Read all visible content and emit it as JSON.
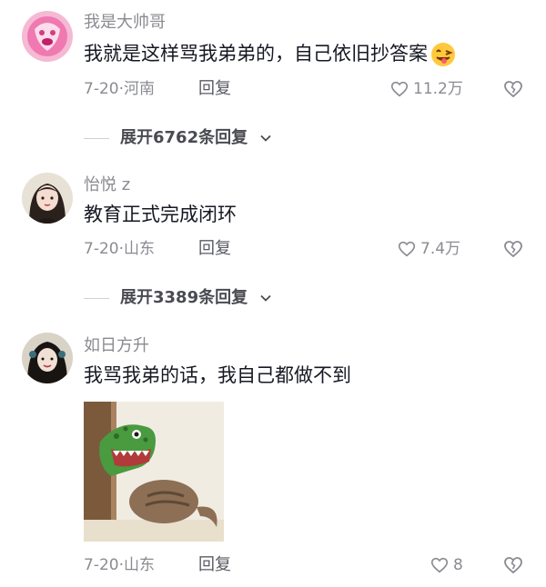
{
  "comments": [
    {
      "username": "我是大帅哥",
      "text": "我就是这样骂我弟弟的，自己依旧抄答案",
      "date_location": "7-20·河南",
      "reply_label": "回复",
      "likes": "11.2万",
      "expand_label": "展开6762条回复",
      "emoji": "winking-tongue-emoji"
    },
    {
      "username": "怡悦 z",
      "text": "教育正式完成闭环",
      "date_location": "7-20·山东",
      "reply_label": "回复",
      "likes": "7.4万",
      "expand_label": "展开3389条回复"
    },
    {
      "username": "如日方升",
      "text": "我骂我弟的话，我自己都做不到",
      "date_location": "7-20·山东",
      "reply_label": "回复",
      "likes": "8",
      "image": "cat-in-green-dinosaur-mask"
    }
  ],
  "colors": {
    "primary_text": "#161823",
    "secondary_text": "#8a8b91",
    "background": "#ffffff"
  }
}
